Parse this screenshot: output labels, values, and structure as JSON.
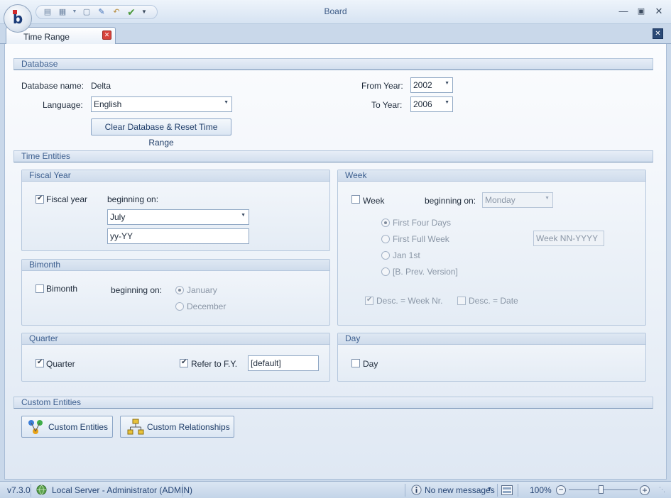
{
  "window": {
    "title": "Board"
  },
  "quick_access": {
    "icons": [
      "new-icon",
      "save-icon",
      "dropdown-arrow-icon",
      "form-icon",
      "edit-icon",
      "undo-icon",
      "checkmark-icon",
      "customize-icon"
    ]
  },
  "tab": {
    "label": "Time Range"
  },
  "database": {
    "header": "Database",
    "name_label": "Database name:",
    "name_value": "Delta",
    "language_label": "Language:",
    "language_value": "English",
    "from_year_label": "From Year:",
    "from_year_value": "2002",
    "to_year_label": "To Year:",
    "to_year_value": "2006",
    "clear_button": "Clear Database & Reset Time Range"
  },
  "time_entities": {
    "header": "Time Entities",
    "fiscal_year": {
      "title": "Fiscal Year",
      "checkbox_label": "Fiscal year",
      "checked": true,
      "beginning_label": "beginning on:",
      "month_value": "July",
      "format_value": "yy-YY"
    },
    "bimonth": {
      "title": "Bimonth",
      "checkbox_label": "Bimonth",
      "checked": false,
      "beginning_label": "beginning on:",
      "option_january": "January",
      "option_december": "December"
    },
    "quarter": {
      "title": "Quarter",
      "checkbox_label": "Quarter",
      "checked": true,
      "refer_label": "Refer to F.Y.",
      "refer_checked": true,
      "refer_value": "[default]"
    },
    "week": {
      "title": "Week",
      "checkbox_label": "Week",
      "checked": false,
      "beginning_label": "beginning on:",
      "day_value": "Monday",
      "options": [
        "First Four Days",
        "First Full Week",
        "Jan 1st",
        "[B. Prev. Version]"
      ],
      "format_placeholder": "Week NN-YYYY",
      "desc_week_label": "Desc. = Week Nr.",
      "desc_date_label": "Desc. =  Date"
    },
    "day": {
      "title": "Day",
      "checkbox_label": "Day",
      "checked": false
    }
  },
  "custom_entities": {
    "header": "Custom Entities",
    "entities_button": "Custom Entities",
    "relationships_button": "Custom Relationships"
  },
  "status_bar": {
    "version": "v7.3.0",
    "server": "Local Server - Administrator (ADMIN)",
    "messages": "No new messages",
    "zoom": "100%"
  }
}
